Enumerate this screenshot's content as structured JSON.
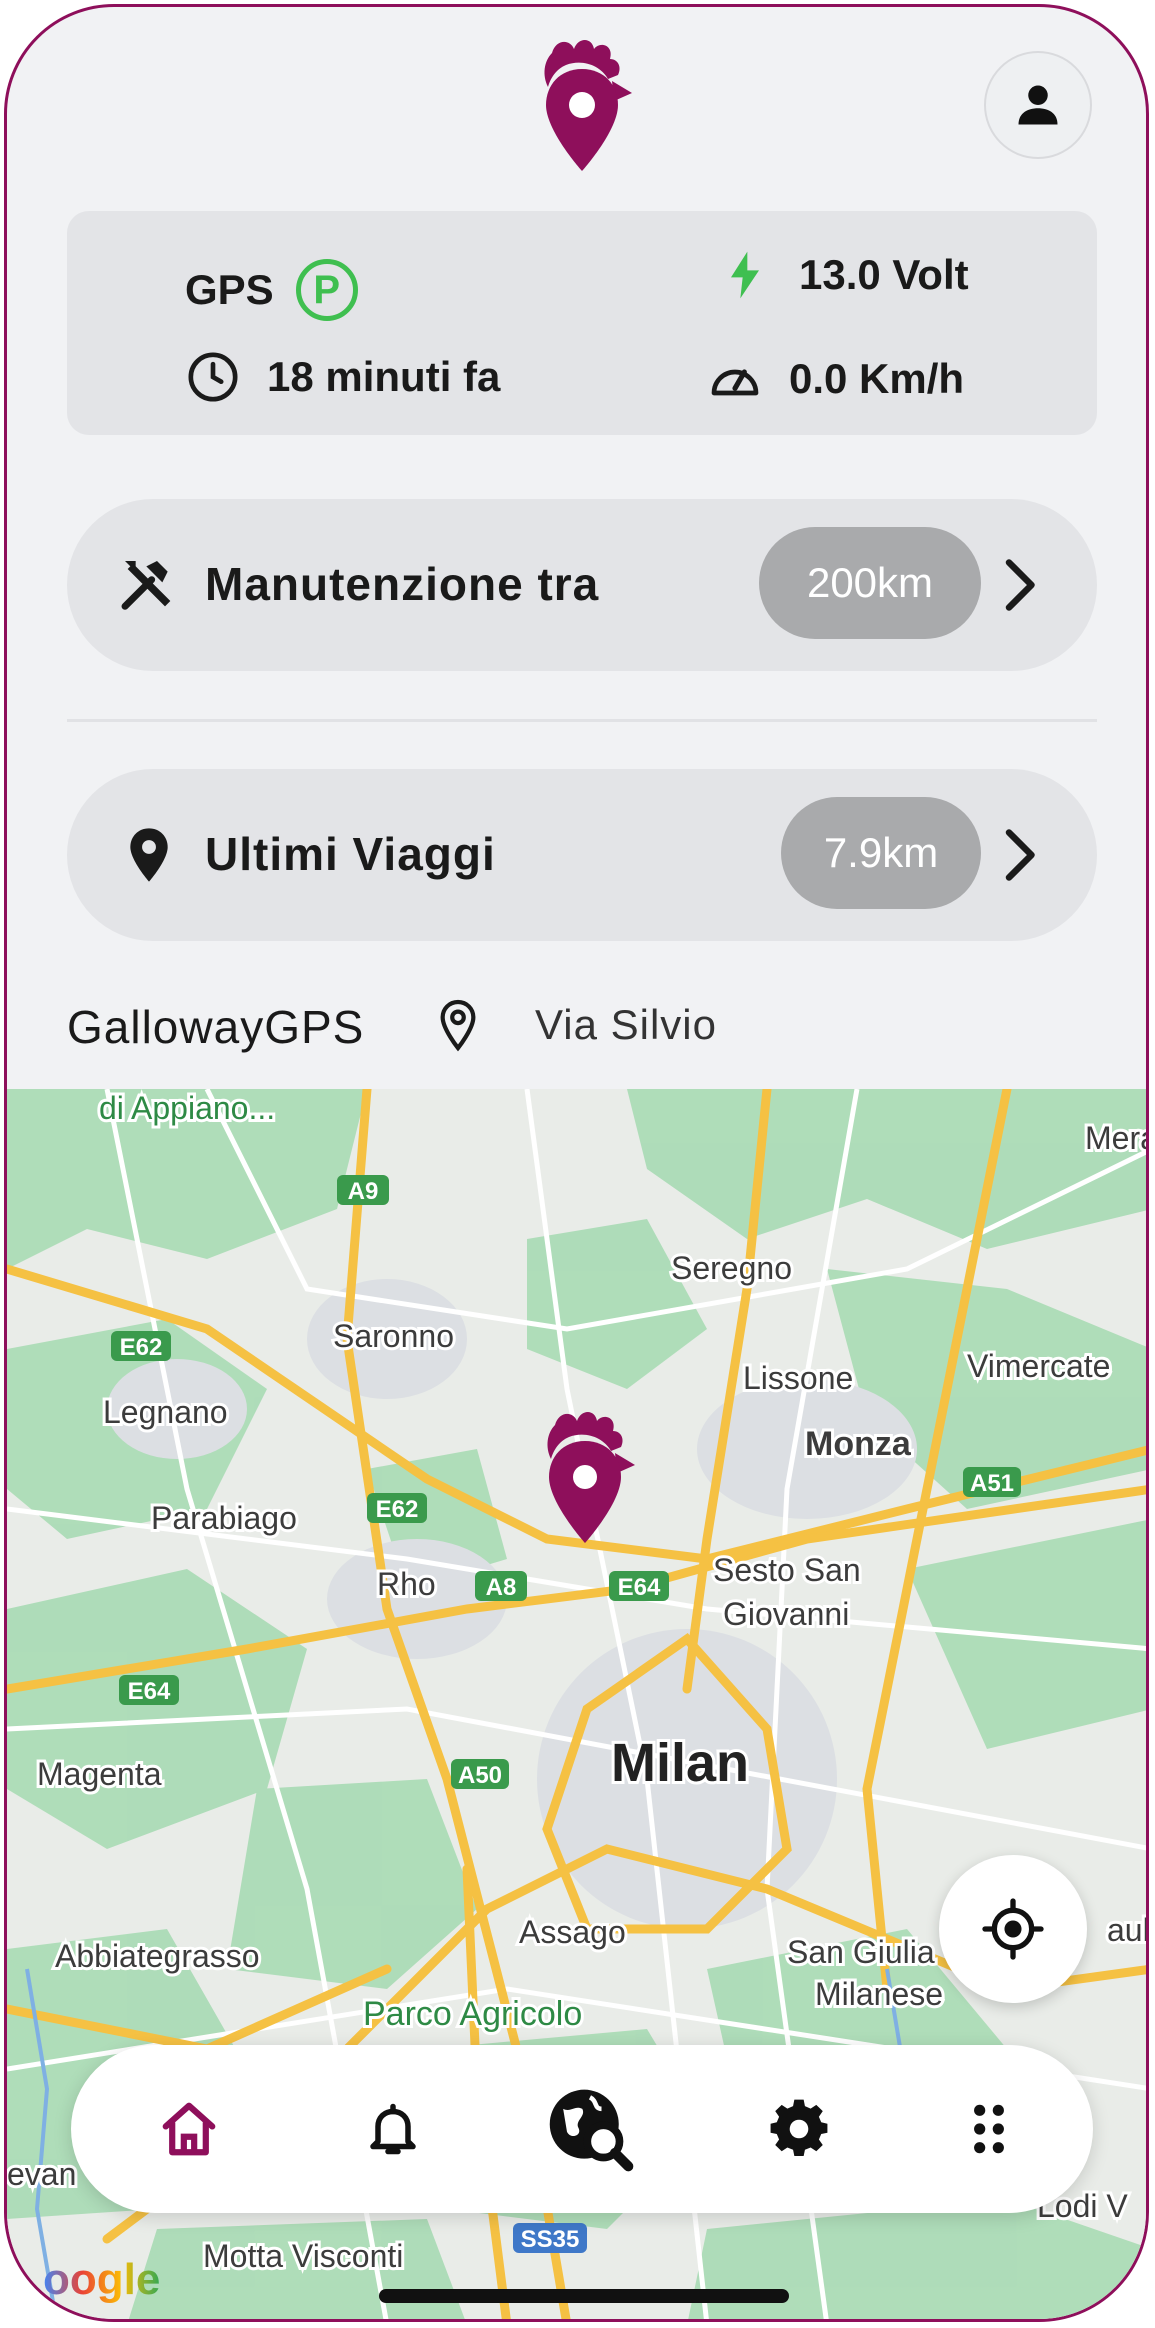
{
  "header": {
    "logo_icon": "rooster-pin-logo",
    "profile_icon": "person-icon"
  },
  "status": {
    "gps_label": "GPS",
    "gps_badge": "P",
    "time_ago": "18 minuti fa",
    "voltage": "13.0 Volt",
    "speed": "0.0 Km/h"
  },
  "maintenance": {
    "label": "Manutenzione tra",
    "distance": "200km"
  },
  "trips": {
    "label": "Ultimi Viaggi",
    "distance": "7.9km"
  },
  "device": {
    "name": "GallowayGPS",
    "address": "Via Silvio"
  },
  "map": {
    "labels": {
      "appiano": "di Appiano...",
      "mera": "Mera",
      "seregno": "Seregno",
      "saronno": "Saronno",
      "lissone": "Lissone",
      "vimercate": "Vimercate",
      "legnano": "Legnano",
      "monza": "Monza",
      "parabiago": "Parabiago",
      "rho": "Rho",
      "sesto1": "Sesto San",
      "sesto2": "Giovanni",
      "milan": "Milan",
      "magenta": "Magenta",
      "assago": "Assago",
      "abbiategrasso": "Abbiategrasso",
      "sangiuliano1": "San Giulia",
      "sangiuliano2": "Milanese",
      "paullo": "aullo",
      "parco": "Parco Agricolo",
      "vevan": "evan",
      "lodi": "Lodi V",
      "motta": "Motta Visconti",
      "google": "oogle"
    },
    "shields": {
      "a9": "A9",
      "e62a": "E62",
      "e62b": "E62",
      "a8": "A8",
      "e64a": "E64",
      "e64b": "E64",
      "a51": "A51",
      "a50": "A50",
      "ss35": "SS35"
    }
  },
  "nav": {
    "items": [
      "home-icon",
      "bell-icon",
      "globe-search-icon",
      "gear-icon",
      "apps-grid-icon"
    ],
    "active": "home-icon",
    "accent": "#8e0f5b"
  },
  "colors": {
    "brand": "#8e0f5b",
    "gps_green": "#3fbf50"
  }
}
